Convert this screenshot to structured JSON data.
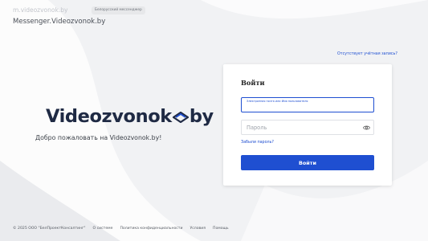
{
  "header": {
    "site_url": "m.videozvonok.by",
    "badge": "Белорусский мессенджер",
    "site_title": "Messenger.Videozvonok.by"
  },
  "hero": {
    "logo_left": "Videozvonok",
    "logo_right": "by",
    "welcome": "Добро пожаловать на Videozvonok.by!"
  },
  "links": {
    "no_account": "Отсутствует учётная запись?"
  },
  "login_card": {
    "title": "Войти",
    "email_label": "Электронная почта или Имя пользователя",
    "email_value": "",
    "password_placeholder": "Пароль",
    "forgot_password": "Забыли пароль?",
    "submit": "Войти"
  },
  "footer": {
    "copyright": "© 2025 ООО \"БелПроектКонсалтинг\"",
    "links": [
      "О системе",
      "Политика конфиденциальности",
      "Условия",
      "Помощь"
    ]
  },
  "colors": {
    "accent": "#1f4fd1",
    "logo": "#1f2a44",
    "background": "#f1f2f4"
  },
  "icons": {
    "password_toggle": "eye-icon"
  }
}
